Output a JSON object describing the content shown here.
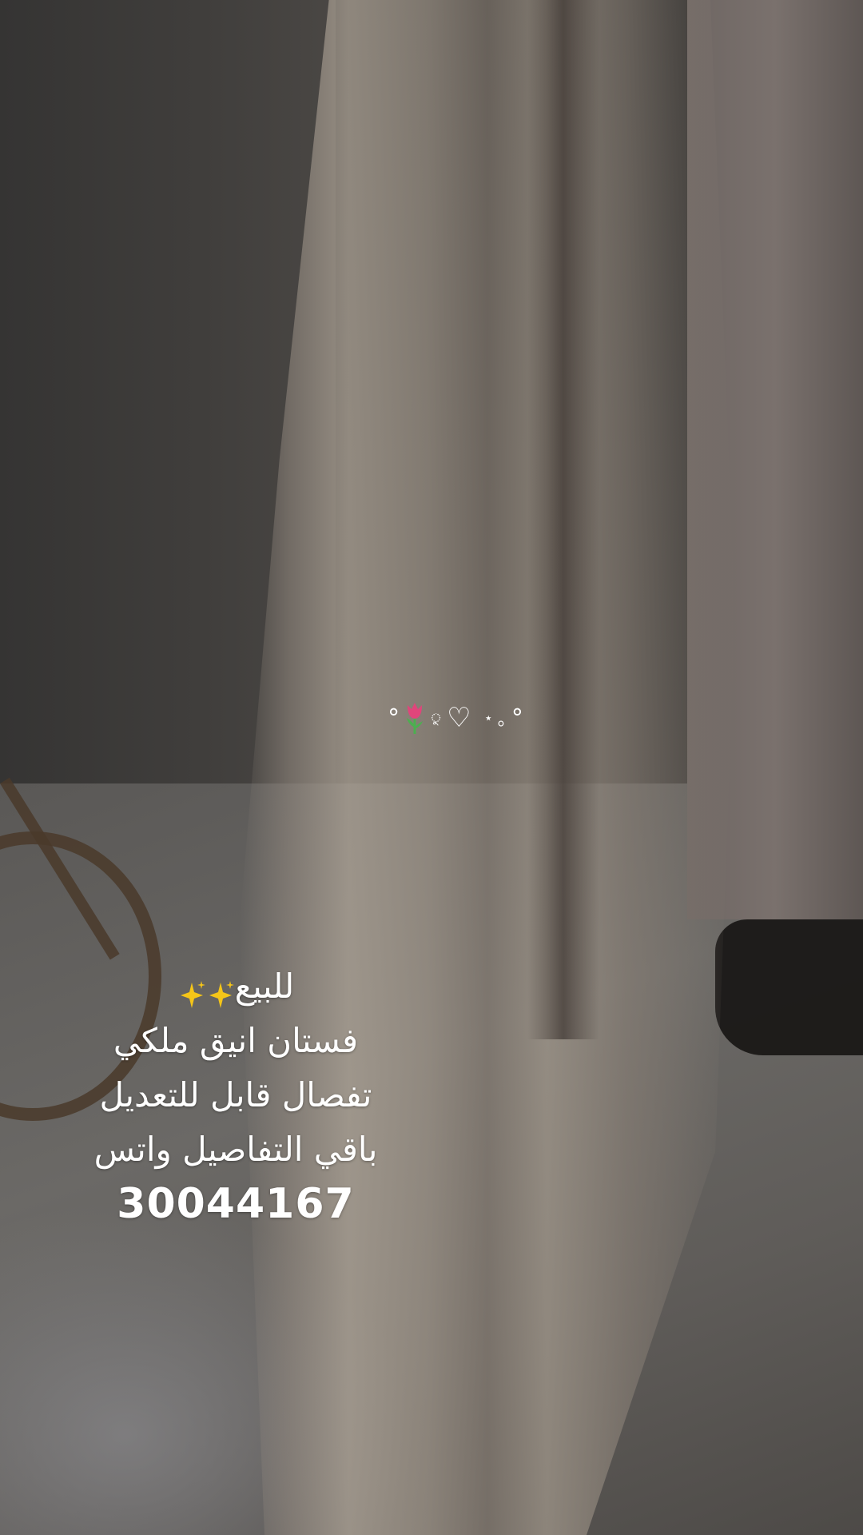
{
  "overlay": {
    "decoration": {
      "left_text": "°",
      "heart": "♡",
      "tiny_text": "ু",
      "star": "⋆",
      "circle": "｡",
      "right_text": "°",
      "icons": [
        "tulip-icon",
        "heart-icon",
        "star-icon"
      ]
    },
    "caption": {
      "line1": "للبيع",
      "line2": "فستان انيق ملكي",
      "line3": "تفصال قابل للتعديل",
      "line4": "باقي التفاصيل واتس",
      "phone": "30044167",
      "sparkle_icons": [
        "sparkles-icon",
        "sparkles-icon"
      ]
    }
  },
  "colors": {
    "text": "#ffffff",
    "sparkle": "#f5c518",
    "tulip_petal": "#e0457b",
    "tulip_stem": "#4caf50"
  }
}
